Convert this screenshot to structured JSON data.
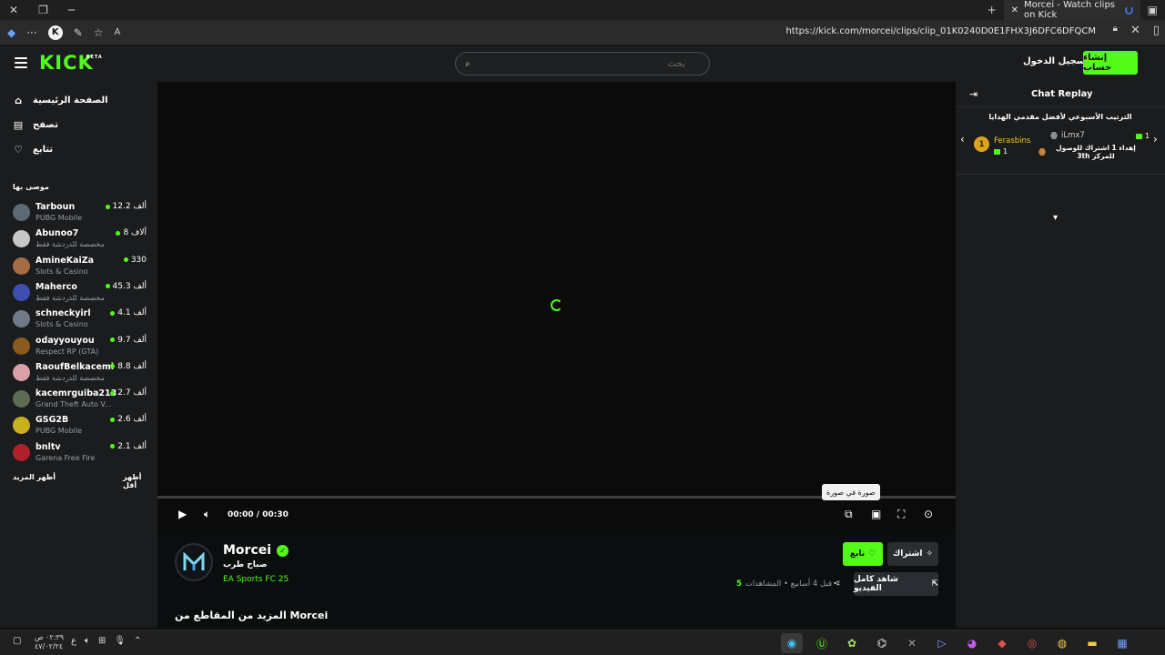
{
  "browser": {
    "tab_title": "Morcei - Watch clips on Kick",
    "url": "https://kick.com/morcei/clips/clip_01K0240D0E1FHX3J6DFC6DFQCM"
  },
  "header": {
    "logo": "KICK",
    "logo_beta": "BETA",
    "search_placeholder": "بحث",
    "login": "تسجيل الدخول",
    "signup": "إنشاء حساب"
  },
  "sidebar": {
    "nav": [
      {
        "label": "الصفحة الرئيسية",
        "icon": "home-icon"
      },
      {
        "label": "تصفح",
        "icon": "browse-icon"
      },
      {
        "label": "تتابع",
        "icon": "heart-icon"
      }
    ],
    "recommended_title": "موصى بها",
    "channels": [
      {
        "name": "Tarboun",
        "category": "PUBG Mobile",
        "viewers": "12.2 ألف",
        "color": "#5b6a74"
      },
      {
        "name": "Abunoo7",
        "category": "مخصصة للدردشة فقط",
        "viewers": "8 آلاف",
        "color": "#c8c8c8"
      },
      {
        "name": "AmineKaiZa",
        "category": "Slots & Casino",
        "viewers": "330",
        "color": "#a46b44"
      },
      {
        "name": "Maherco",
        "category": "مخصصة للدردشة فقط",
        "viewers": "45.3 ألف",
        "color": "#3b4fb0"
      },
      {
        "name": "schneckyirl",
        "category": "Slots & Casino",
        "viewers": "4.1 ألف",
        "color": "#6f7a86"
      },
      {
        "name": "odayyouyou",
        "category": "Respect RP (GTA)",
        "viewers": "9.7 ألف",
        "color": "#8a5a1e"
      },
      {
        "name": "RaoufBelkacemi",
        "category": "مخصصة للدردشة فقط",
        "viewers": "8.8 ألف",
        "color": "#d9a0a8"
      },
      {
        "name": "kacemrguiba213",
        "category": "Grand Theft Auto V...",
        "viewers": "2.7 ألف",
        "color": "#5d6b55"
      },
      {
        "name": "GSG2B",
        "category": "PUBG Mobile",
        "viewers": "2.6 ألف",
        "color": "#c9b020"
      },
      {
        "name": "bnltv",
        "category": "Garena Free Fire",
        "viewers": "2.1 ألف",
        "color": "#b0202a"
      }
    ],
    "show_more": "أظهر المزيد",
    "show_less": "أظهر أقل"
  },
  "player": {
    "time": "00:00 / 00:30",
    "tooltip": "صورة في صورة"
  },
  "clip": {
    "channel": "Morcei",
    "title": "صباح طرب",
    "game": "EA Sports FC 25",
    "follow": "تابع",
    "subscribe": "اشتراك",
    "watch_full": "شاهد كامل الفيديو",
    "views_count": "5",
    "views_text": "قبل 4 أسابيع • المشاهدات",
    "more_clips": "المزيد من المقاطع من Morcei"
  },
  "chat": {
    "title": "Chat Replay",
    "leaderboard_title": "الترتيب الأسبوعي لأفضل مقدمي الهدايا",
    "rank_medal": "1",
    "top_name": "Ferasbins",
    "top_value": "1",
    "second_user": "iLmx7",
    "second_value": "1",
    "description": "إهداء 1 اشتراك للوصول للمركز 3th"
  },
  "taskbar": {
    "time": "٠٢:٣٩ ص",
    "date": "٤٧/٠٢/٢٤",
    "lang": "ع"
  },
  "colors": {
    "accent": "#53fc18",
    "background": "#0b0e0f",
    "panel": "#1a1c1e"
  }
}
